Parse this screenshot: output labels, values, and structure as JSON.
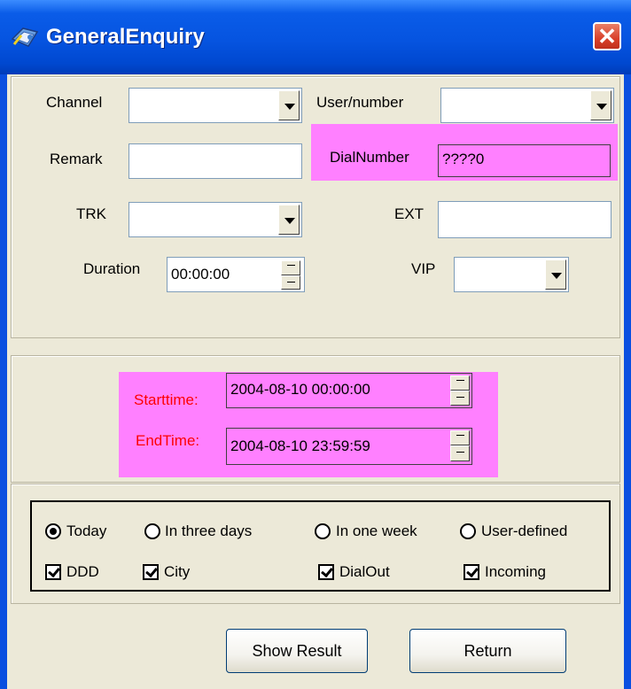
{
  "window": {
    "title": "GeneralEnquiry",
    "close_glyph": "✕"
  },
  "fields": {
    "channel": {
      "label": "Channel",
      "value": ""
    },
    "user_number": {
      "label": "User/number",
      "value": ""
    },
    "remark": {
      "label": "Remark",
      "value": ""
    },
    "dial_number": {
      "label": "DialNumber",
      "value": "????0"
    },
    "trk": {
      "label": "TRK",
      "value": ""
    },
    "ext": {
      "label": "EXT",
      "value": ""
    },
    "duration": {
      "label": "Duration",
      "value": "00:00:00"
    },
    "vip": {
      "label": "VIP",
      "value": ""
    }
  },
  "time_range": {
    "start_label": "Starttime:",
    "start_value": "2004-08-10 00:00:00",
    "end_label": "EndTime:",
    "end_value": "2004-08-10 23:59:59"
  },
  "period": {
    "today": {
      "label": "Today",
      "selected": true
    },
    "three_days": {
      "label": "In three days",
      "selected": false
    },
    "one_week": {
      "label": "In one week",
      "selected": false
    },
    "user_defined": {
      "label": "User-defined",
      "selected": false
    }
  },
  "types": {
    "ddd": {
      "label": "DDD",
      "checked": true
    },
    "city": {
      "label": "City",
      "checked": true
    },
    "dialout": {
      "label": "DialOut",
      "checked": true
    },
    "incoming": {
      "label": "Incoming",
      "checked": true
    }
  },
  "buttons": {
    "show_result": "Show Result",
    "return": "Return"
  },
  "colors": {
    "title_bar": "#0a5ce8",
    "highlight": "#ff80ff",
    "time_label": "#ff0000",
    "face": "#ece9d8"
  },
  "icons": [
    "app-icon",
    "close-icon",
    "chevron-down-icon",
    "spin-up-icon",
    "spin-down-icon"
  ]
}
